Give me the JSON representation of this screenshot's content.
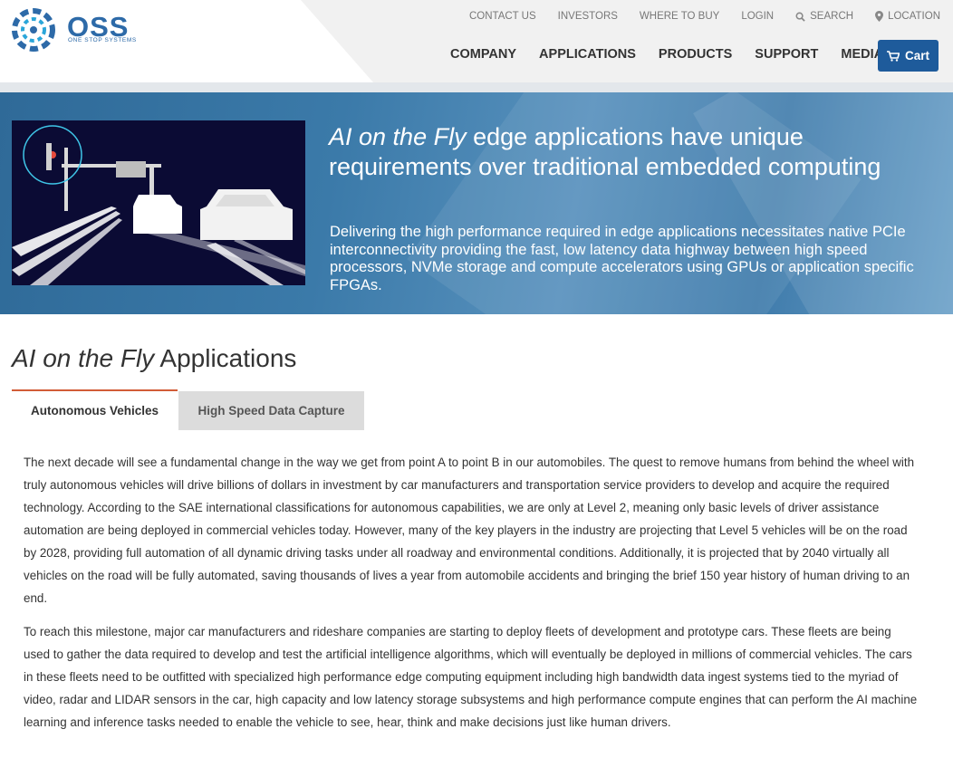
{
  "brand": {
    "name": "OSS",
    "tagline": "ONE STOP SYSTEMS"
  },
  "top_nav": {
    "contact": "CONTACT US",
    "investors": "INVESTORS",
    "where_to_buy": "WHERE TO BUY",
    "login": "LOGIN",
    "search": "SEARCH",
    "location": "LOCATION"
  },
  "main_nav": {
    "company": "COMPANY",
    "applications": "APPLICATIONS",
    "products": "PRODUCTS",
    "support": "SUPPORT",
    "media": "MEDIA",
    "cart": "Cart"
  },
  "hero": {
    "title_em": "AI on the Fly",
    "title_rest": " edge applications have unique requirements over traditional embedded computing",
    "description": "Delivering the high performance required in edge applications necessitates native PCIe interconnectivity providing the fast, low latency data highway between high speed processors, NVMe storage and compute accelerators using GPUs or application specific FPGAs."
  },
  "section": {
    "heading_em": "AI on the Fly",
    "heading_rest": " Applications"
  },
  "tabs": {
    "active": "Autonomous Vehicles",
    "inactive": "High Speed Data Capture"
  },
  "content": {
    "paragraph1": "The next decade will see a fundamental change in the way we get from point A to point B in our automobiles. The quest to remove humans from behind the wheel with truly autonomous vehicles will drive billions of dollars in investment by car manufacturers and transportation service providers to develop and acquire the required technology. According to the SAE international classifications for autonomous capabilities, we are only at Level 2, meaning only basic levels of driver assistance automation are being deployed in commercial vehicles today. However, many of the key players in the industry are projecting that Level 5 vehicles will be on the road by 2028, providing full automation of all dynamic driving tasks under all roadway and environmental conditions. Additionally, it is projected that by 2040 virtually all vehicles on the road will be fully automated, saving thousands of lives a year from automobile accidents and bringing the brief 150 year history of human driving to an end.",
    "paragraph2": "To reach this milestone, major car manufacturers and rideshare companies are starting to deploy fleets of development and prototype cars. These fleets are being used to gather the data required to develop and test the artificial intelligence algorithms, which will eventually be deployed in millions of commercial vehicles. The cars in these fleets need to be outfitted with specialized high performance edge computing equipment including high bandwidth data ingest systems tied to the myriad of video, radar and LIDAR sensors in the car, high capacity and low latency storage subsystems and high performance compute engines that can perform the AI machine learning and inference tasks needed to enable the vehicle to see, hear, think and make decisions just like human drivers."
  },
  "colors": {
    "brand_blue": "#2d6aa8",
    "cart_button": "#1e5b9b",
    "tab_accent": "#d25c37",
    "hero_blue": "#3b7aa9"
  },
  "icons": {
    "search": "search-icon",
    "location": "map-pin-icon",
    "cart": "cart-icon"
  }
}
